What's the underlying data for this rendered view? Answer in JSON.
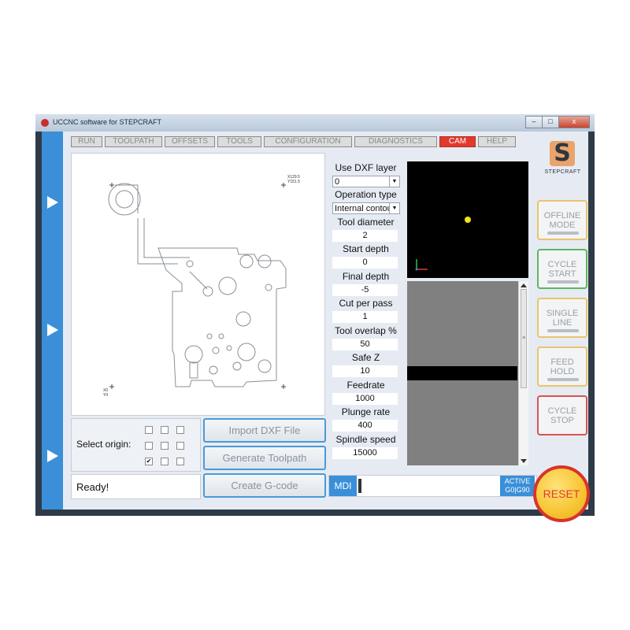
{
  "window": {
    "title": "UCCNC software for STEPCRAFT",
    "controls": {
      "minimize": "–",
      "maximize": "□",
      "close": "x"
    }
  },
  "tabs": [
    {
      "label": "RUN",
      "active": false
    },
    {
      "label": "TOOLPATH",
      "active": false
    },
    {
      "label": "OFFSETS",
      "active": false
    },
    {
      "label": "TOOLS",
      "active": false
    },
    {
      "label": "CONFIGURATION",
      "active": false
    },
    {
      "label": "DIAGNOSTICS",
      "active": false
    },
    {
      "label": "CAM",
      "active": true
    },
    {
      "label": "HELP",
      "active": false
    }
  ],
  "canvas": {
    "coord_top_right": {
      "x": "X129.5",
      "y": "Y151.5"
    },
    "coord_bottom_left": {
      "x": "X0",
      "y": "Y0"
    }
  },
  "origin": {
    "label": "Select origin:",
    "grid": [
      [
        false,
        false,
        false
      ],
      [
        false,
        false,
        false
      ],
      [
        true,
        false,
        false
      ]
    ]
  },
  "status": {
    "text": "Ready!"
  },
  "actions": {
    "import": "Import DXF File",
    "generate": "Generate Toolpath",
    "create": "Create G-code"
  },
  "params": {
    "dxf_layer": {
      "label": "Use DXF layer",
      "value": "0"
    },
    "operation_type": {
      "label": "Operation type",
      "value": "Internal contour"
    },
    "tool_diameter": {
      "label": "Tool diameter",
      "value": "2"
    },
    "start_depth": {
      "label": "Start depth",
      "value": "0"
    },
    "final_depth": {
      "label": "Final depth",
      "value": "-5"
    },
    "cut_per_pass": {
      "label": "Cut per pass",
      "value": "1"
    },
    "tool_overlap": {
      "label": "Tool overlap %",
      "value": "50"
    },
    "safe_z": {
      "label": "Safe Z",
      "value": "10"
    },
    "feedrate": {
      "label": "Feedrate",
      "value": "1000"
    },
    "plunge_rate": {
      "label": "Plunge rate",
      "value": "400"
    },
    "spindle_speed": {
      "label": "Spindle speed",
      "value": "15000"
    }
  },
  "mdi": {
    "label": "MDI",
    "active_line1": "ACTIVE",
    "active_line2": "G0|G90"
  },
  "brand": {
    "name": "STEPCRAFT",
    "glyph": "S"
  },
  "side_buttons": [
    {
      "line1": "OFFLINE",
      "line2": "MODE",
      "border": "#e9c46a"
    },
    {
      "line1": "CYCLE",
      "line2": "START",
      "border": "#5cb85c"
    },
    {
      "line1": "SINGLE",
      "line2": "LINE",
      "border": "#e9c46a"
    },
    {
      "line1": "FEED",
      "line2": "HOLD",
      "border": "#e9c46a"
    },
    {
      "line1": "CYCLE",
      "line2": "STOP",
      "border": "#d9534f"
    }
  ],
  "reset": {
    "label": "RESET"
  },
  "colors": {
    "accent_blue": "#3a8fd8",
    "tab_active": "#e03a2c",
    "reset_fill": "#f7c531",
    "reset_ring": "#d9332a",
    "preview_dot": "#f2e21a"
  }
}
